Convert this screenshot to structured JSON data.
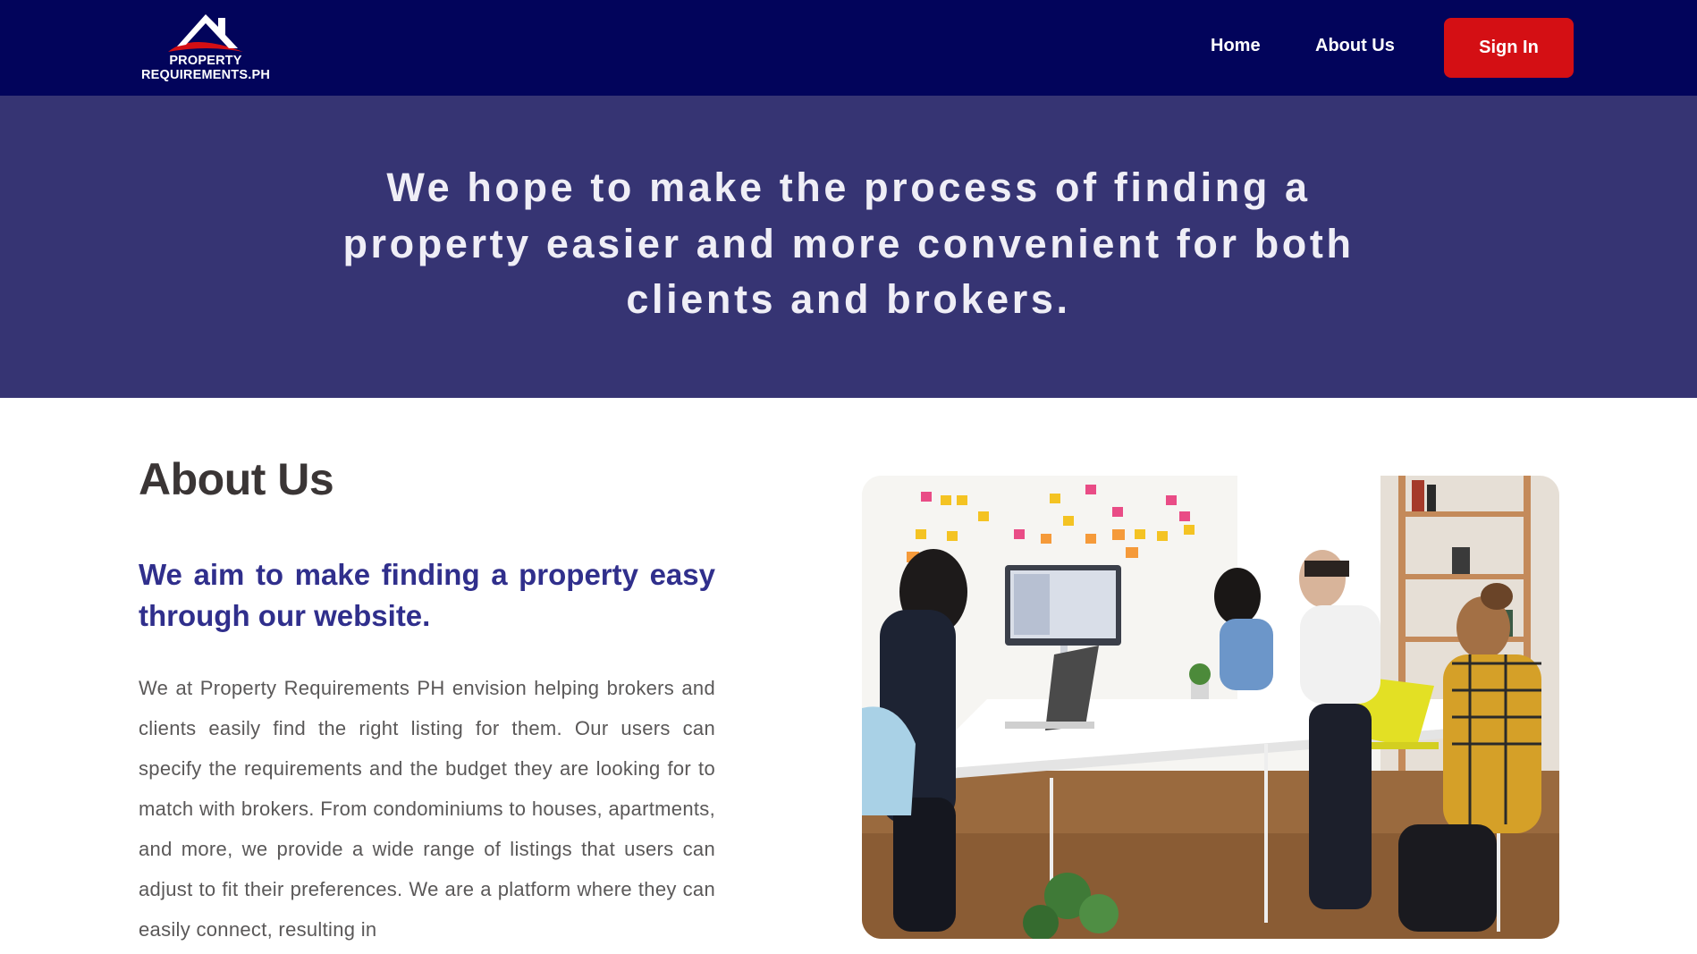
{
  "header": {
    "logo_alt": "house-roof-logo",
    "logo_line1": "PROPERTY",
    "logo_line2": "REQUIREMENTS.PH",
    "nav": {
      "home": "Home",
      "about": "About Us"
    },
    "sign_in": "Sign In"
  },
  "hero": {
    "text": "We hope to make the process of finding a property easier and more convenient for both clients and brokers."
  },
  "about": {
    "title": "About Us",
    "subtitle": "We aim to make finding a property easy through our website.",
    "body": "We at Property Requirements PH envision helping brokers and clients easily find the right listing for them. Our users can specify the requirements and the budget they are looking for to match with brokers. From condominiums to houses, apartments, and more, we provide a wide range of listings that users can adjust to fit their preferences. We are a platform where they can easily connect, resulting in"
  },
  "photo": {
    "description_icon": "team-meeting-photo"
  },
  "colors": {
    "navbar": "#02045b",
    "hero": "#363473",
    "sign_in": "#d40f14",
    "subtitle": "#302f8c",
    "title": "#3a3535",
    "body_text": "#5a5858"
  }
}
